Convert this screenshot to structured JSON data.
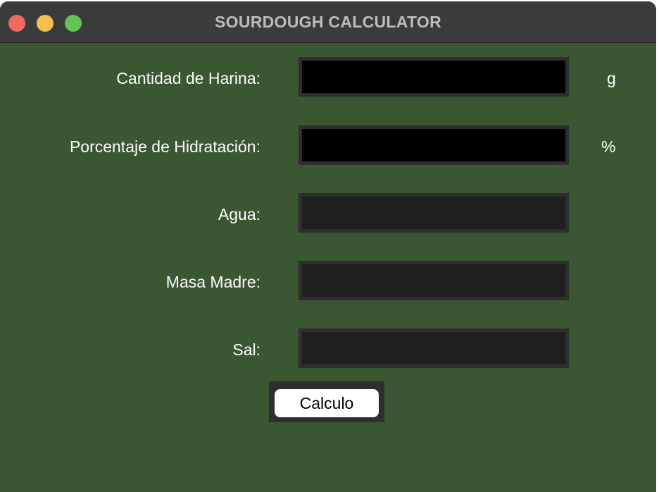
{
  "window": {
    "title": "SOURDOUGH CALCULATOR"
  },
  "form": {
    "harina": {
      "label": "Cantidad de Harina:",
      "value": "",
      "unit": "g"
    },
    "hidratacion": {
      "label": "Porcentaje de Hidratación:",
      "value": "",
      "unit": "%"
    },
    "agua": {
      "label": "Agua:",
      "value": ""
    },
    "masa_madre": {
      "label": "Masa Madre:",
      "value": ""
    },
    "sal": {
      "label": "Sal:",
      "value": ""
    },
    "button_label": "Calculo"
  },
  "colors": {
    "background": "#3a5632",
    "titlebar": "#3b3b3b",
    "input_editable": "#000000",
    "input_readonly": "#1f1f1f"
  }
}
